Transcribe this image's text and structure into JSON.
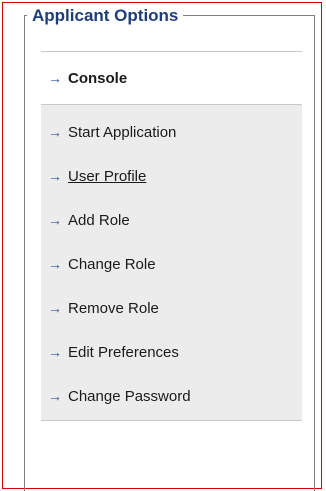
{
  "panel": {
    "title": "Applicant Options"
  },
  "menu": {
    "active_item": {
      "label": "Console",
      "icon": "arrow-right-icon"
    },
    "items": [
      {
        "label": "Start Application",
        "icon": "arrow-right-icon"
      },
      {
        "label": "User Profile",
        "icon": "arrow-right-icon",
        "underlined": true
      },
      {
        "label": "Add Role",
        "icon": "arrow-right-icon"
      },
      {
        "label": "Change Role",
        "icon": "arrow-right-icon"
      },
      {
        "label": "Remove Role",
        "icon": "arrow-right-icon"
      },
      {
        "label": "Edit Preferences",
        "icon": "arrow-right-icon"
      },
      {
        "label": "Change Password",
        "icon": "arrow-right-icon"
      }
    ]
  },
  "colors": {
    "frame_border": "#d40000",
    "title_text": "#1f3e78",
    "arrow": "#2a55a6",
    "list_background": "#ececec"
  }
}
